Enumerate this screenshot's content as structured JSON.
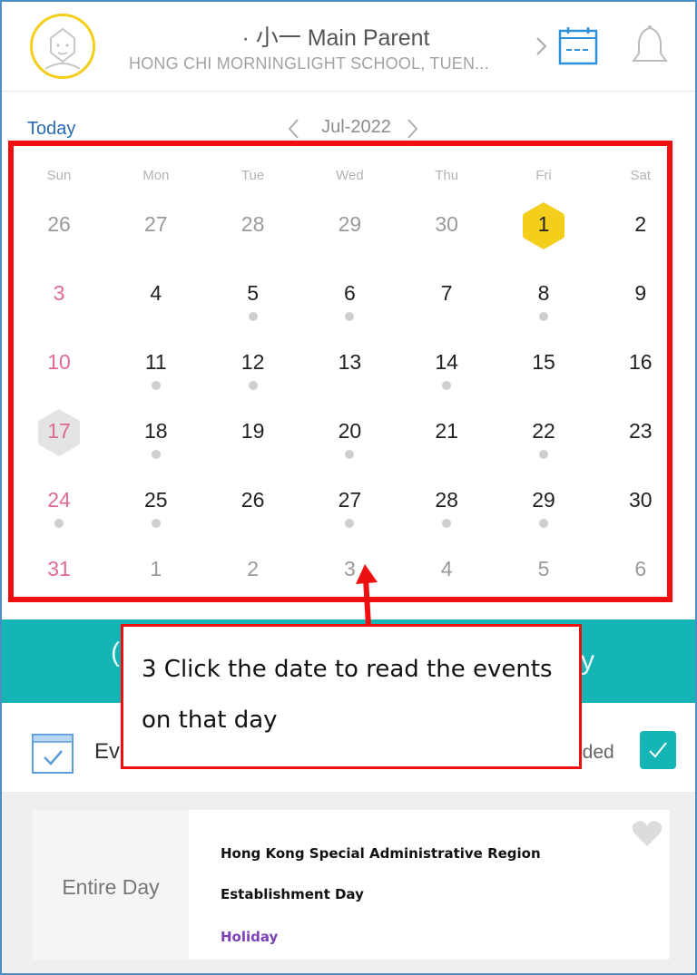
{
  "header": {
    "parent_name": "· 小一  Main Parent",
    "school_name": "HONG CHI MORNINGLIGHT SCHOOL, TUEN...",
    "icons": [
      "avatar-icon",
      "chevron-right-icon",
      "calendar-icon",
      "bell-icon"
    ]
  },
  "nav": {
    "today": "Today",
    "month": "Jul-2022"
  },
  "calendar": {
    "weekdays": [
      "Sun",
      "Mon",
      "Tue",
      "Wed",
      "Thu",
      "Fri",
      "Sat"
    ],
    "weeks": [
      [
        {
          "d": "26",
          "other": true,
          "dot": false
        },
        {
          "d": "27",
          "other": true,
          "dot": false
        },
        {
          "d": "28",
          "other": true,
          "dot": false
        },
        {
          "d": "29",
          "other": true,
          "dot": false
        },
        {
          "d": "30",
          "other": true,
          "dot": false
        },
        {
          "d": "1",
          "other": false,
          "dot": false,
          "today": true
        },
        {
          "d": "2",
          "other": false,
          "dot": false
        }
      ],
      [
        {
          "d": "3",
          "other": false,
          "dot": false
        },
        {
          "d": "4",
          "other": false,
          "dot": false
        },
        {
          "d": "5",
          "other": false,
          "dot": true
        },
        {
          "d": "6",
          "other": false,
          "dot": true
        },
        {
          "d": "7",
          "other": false,
          "dot": false
        },
        {
          "d": "8",
          "other": false,
          "dot": true
        },
        {
          "d": "9",
          "other": false,
          "dot": false
        }
      ],
      [
        {
          "d": "10",
          "other": false,
          "dot": false
        },
        {
          "d": "11",
          "other": false,
          "dot": true
        },
        {
          "d": "12",
          "other": false,
          "dot": true
        },
        {
          "d": "13",
          "other": false,
          "dot": false
        },
        {
          "d": "14",
          "other": false,
          "dot": true
        },
        {
          "d": "15",
          "other": false,
          "dot": false
        },
        {
          "d": "16",
          "other": false,
          "dot": false
        }
      ],
      [
        {
          "d": "17",
          "other": false,
          "dot": false,
          "selected": true
        },
        {
          "d": "18",
          "other": false,
          "dot": true
        },
        {
          "d": "19",
          "other": false,
          "dot": false
        },
        {
          "d": "20",
          "other": false,
          "dot": true
        },
        {
          "d": "21",
          "other": false,
          "dot": false
        },
        {
          "d": "22",
          "other": false,
          "dot": true
        },
        {
          "d": "23",
          "other": false,
          "dot": false
        }
      ],
      [
        {
          "d": "24",
          "other": false,
          "dot": true
        },
        {
          "d": "25",
          "other": false,
          "dot": true
        },
        {
          "d": "26",
          "other": false,
          "dot": false
        },
        {
          "d": "27",
          "other": false,
          "dot": true
        },
        {
          "d": "28",
          "other": false,
          "dot": true
        },
        {
          "d": "29",
          "other": false,
          "dot": true
        },
        {
          "d": "30",
          "other": false,
          "dot": false
        }
      ],
      [
        {
          "d": "31",
          "other": false,
          "dot": false
        },
        {
          "d": "1",
          "other": true,
          "dot": false
        },
        {
          "d": "2",
          "other": true,
          "dot": false
        },
        {
          "d": "3",
          "other": true,
          "dot": false
        },
        {
          "d": "4",
          "other": true,
          "dot": false
        },
        {
          "d": "5",
          "other": true,
          "dot": false
        },
        {
          "d": "6",
          "other": true,
          "dot": false
        }
      ]
    ]
  },
  "teal_bar": {
    "left_text": "(",
    "right_text": "y"
  },
  "events_header": {
    "label": "Ev",
    "filter_label": "nded",
    "filter_checked": true
  },
  "event": {
    "time": "Entire Day",
    "title_line1": "Hong Kong Special Administrative Region",
    "title_line2": "Establishment Day",
    "type": "Holiday"
  },
  "callout": {
    "line1": "3 Click the date to read the events",
    "line2": "on that day"
  },
  "colors": {
    "accent": "#16b5b5",
    "today_highlight": "#f3cf1b",
    "sunday": "#e06a91",
    "annotation_red": "#ee1010",
    "holiday_purple": "#7c3fb5"
  }
}
